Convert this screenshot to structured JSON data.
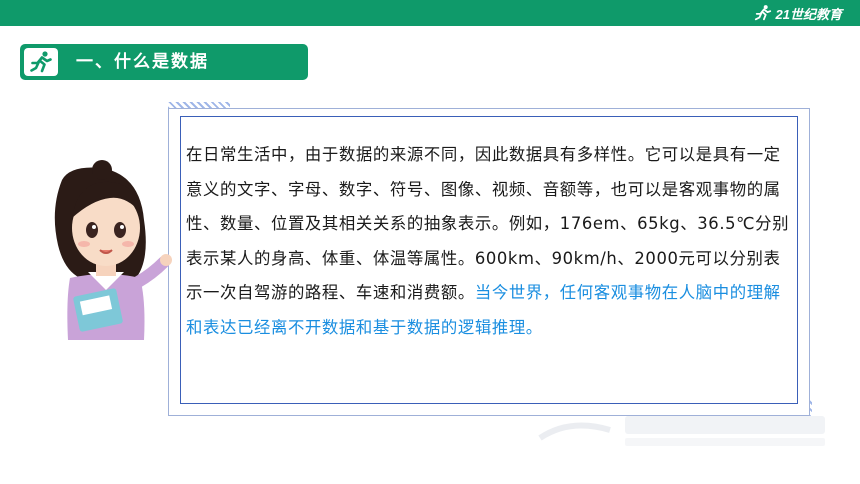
{
  "brand": {
    "logo_icon": "runner-icon",
    "text": "21世纪教育",
    "accent": "#0f9a6a"
  },
  "section": {
    "icon": "runner-icon",
    "title": "一、什么是数据"
  },
  "content": {
    "paragraph_normal": "在日常生活中，由于数据的来源不同，因此数据具有多样性。它可以是具有一定意义的文字、字母、数字、符号、图像、视频、音额等，也可以是客观事物的属性、数量、位置及其相关关系的抽象表示。例如，176em、65kg、36.5℃分别表示某人的身高、体重、体温等属性。600km、90km/h、2000元可以分别表示一次自驾游的路程、车速和消费额。",
    "paragraph_highlight": "当今世界，任何客观事物在人脑中的理解和表达已经离不开数据和基于数据的逻辑推理。",
    "highlight_color": "#1a8ee0"
  },
  "illustration": {
    "icon": "teacher-illustration"
  }
}
